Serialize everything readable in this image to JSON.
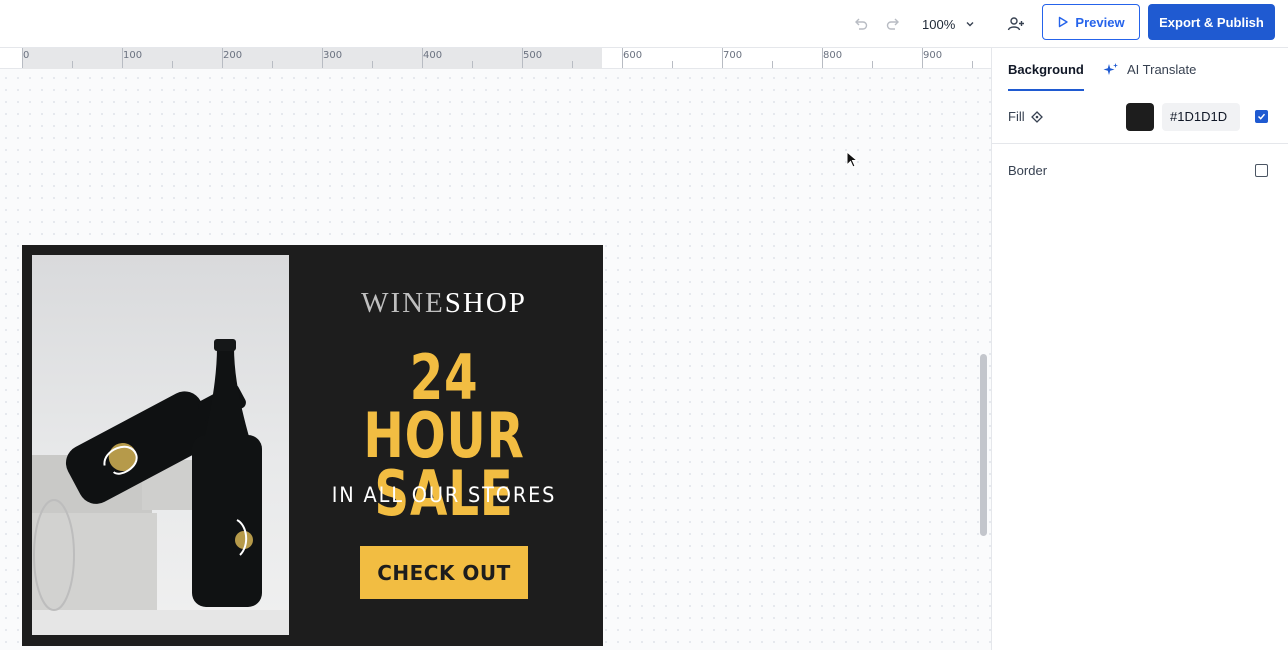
{
  "toolbar": {
    "zoom_value": "100%",
    "preview_label": "Preview",
    "export_label": "Export & Publish"
  },
  "ruler": {
    "labels": [
      "0",
      "100",
      "200",
      "300",
      "400",
      "500",
      "600",
      "700",
      "800",
      "900"
    ]
  },
  "banner": {
    "brand_part1": "WINE",
    "brand_part2": "SHOP",
    "headline_line1": "24 HOUR",
    "headline_line2": "SALE",
    "subline": "IN ALL OUR STORES",
    "cta_label": "CHECK OUT",
    "background_color": "#1D1D1D",
    "accent_color": "#F2BD42"
  },
  "panel": {
    "tabs": [
      {
        "label": "Background",
        "active": true
      },
      {
        "label": "AI Translate",
        "active": false
      }
    ],
    "fill_label": "Fill",
    "fill_hex": "#1D1D1D",
    "fill_enabled": true,
    "border_label": "Border",
    "border_enabled": false
  },
  "colors": {
    "primary": "#1F5AD1",
    "canvas_bg": "#FAFBFC"
  }
}
